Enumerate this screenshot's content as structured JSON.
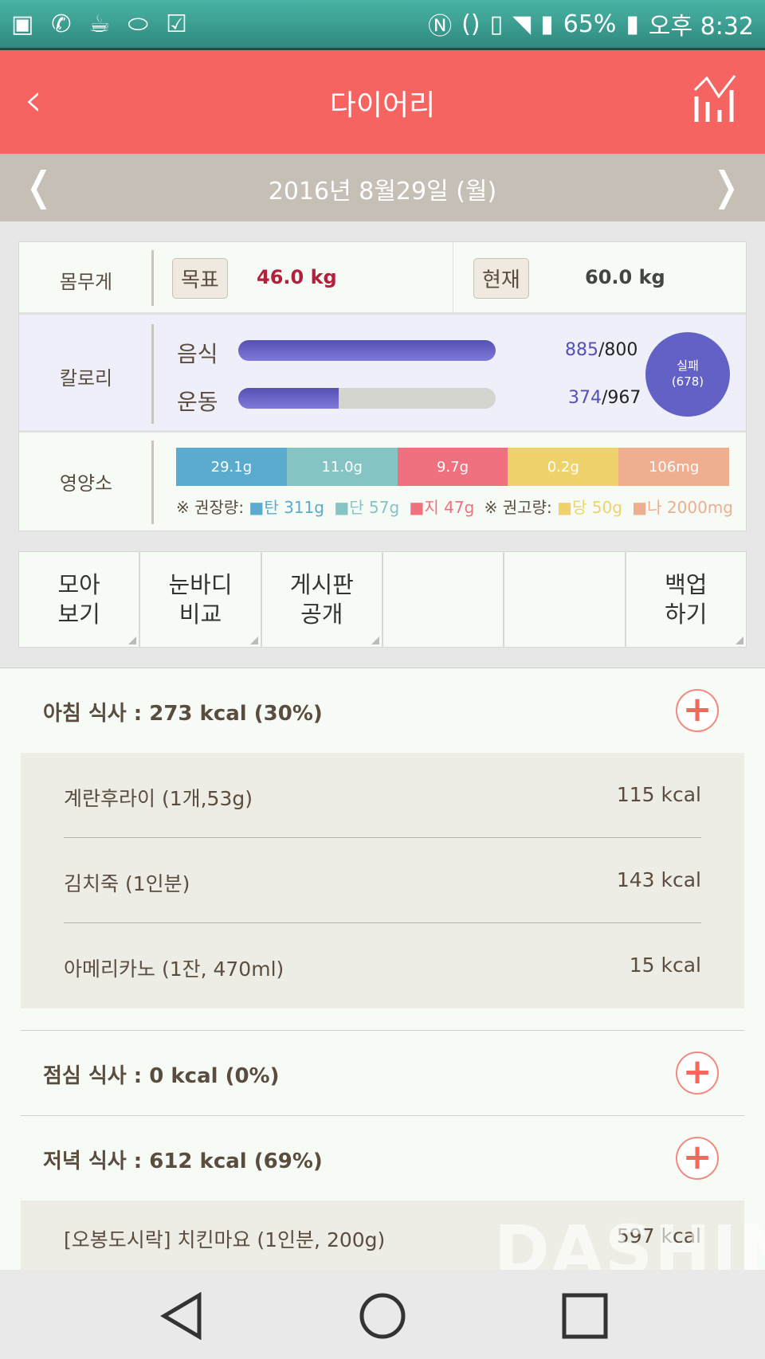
{
  "status_bar": {
    "battery": "65%",
    "time": "오후 8:32"
  },
  "header": {
    "title": "다이어리"
  },
  "date_nav": {
    "date": "2016년 8월29일 (월)"
  },
  "weight": {
    "label": "몸무게",
    "goal_label": "목표",
    "goal_value": "46.0 kg",
    "current_label": "현재",
    "current_value": "60.0 kg"
  },
  "calories": {
    "label": "칼로리",
    "food_label": "음식",
    "food_value": "885",
    "food_target": "/800",
    "food_progress": 1.0,
    "exercise_label": "운동",
    "exercise_value": "374",
    "exercise_target": "/967",
    "exercise_progress": 0.39,
    "result_label": "실패",
    "result_value": "(678)"
  },
  "nutrients": {
    "label": "영양소",
    "bars": [
      {
        "value": "29.1g",
        "color": "#5aabcd"
      },
      {
        "value": "11.0g",
        "color": "#86c3c3"
      },
      {
        "value": "9.7g",
        "color": "#ef717f"
      },
      {
        "value": "0.2g",
        "color": "#efd26c"
      },
      {
        "value": "106mg",
        "color": "#efae8f"
      }
    ],
    "recommend_label": "※ 권장량:",
    "recommend": [
      {
        "text": "탄 311g",
        "color": "#5aabcd"
      },
      {
        "text": "단 57g",
        "color": "#86c3c3"
      },
      {
        "text": "지 47g",
        "color": "#ef717f"
      }
    ],
    "advise_label": "※ 권고량:",
    "advise": [
      {
        "text": "당 50g",
        "color": "#efd26c"
      },
      {
        "text": "나 2000mg",
        "color": "#efae8f"
      }
    ]
  },
  "actions": [
    {
      "label": "모아\n보기"
    },
    {
      "label": "눈바디\n비교"
    },
    {
      "label": "게시판\n공개"
    },
    {
      "label": ""
    },
    {
      "label": ""
    },
    {
      "label": "백업\n하기"
    }
  ],
  "meals": {
    "breakfast": {
      "title": "아침 식사 : 273 kcal (30%)",
      "items": [
        {
          "name": "계란후라이 (1개,53g)",
          "kcal": "115 kcal"
        },
        {
          "name": "김치죽 (1인분)",
          "kcal": "143 kcal"
        },
        {
          "name": "아메리카노 (1잔, 470ml)",
          "kcal": "15 kcal"
        }
      ]
    },
    "lunch": {
      "title": "점심 식사 : 0 kcal (0%)"
    },
    "dinner": {
      "title": "저녁 식사 : 612 kcal (69%)",
      "items": [
        {
          "name": "[오봉도시락] 치킨마요 (1인분, 200g)",
          "kcal": "597 kcal"
        }
      ]
    }
  },
  "watermark": "DASHIN"
}
